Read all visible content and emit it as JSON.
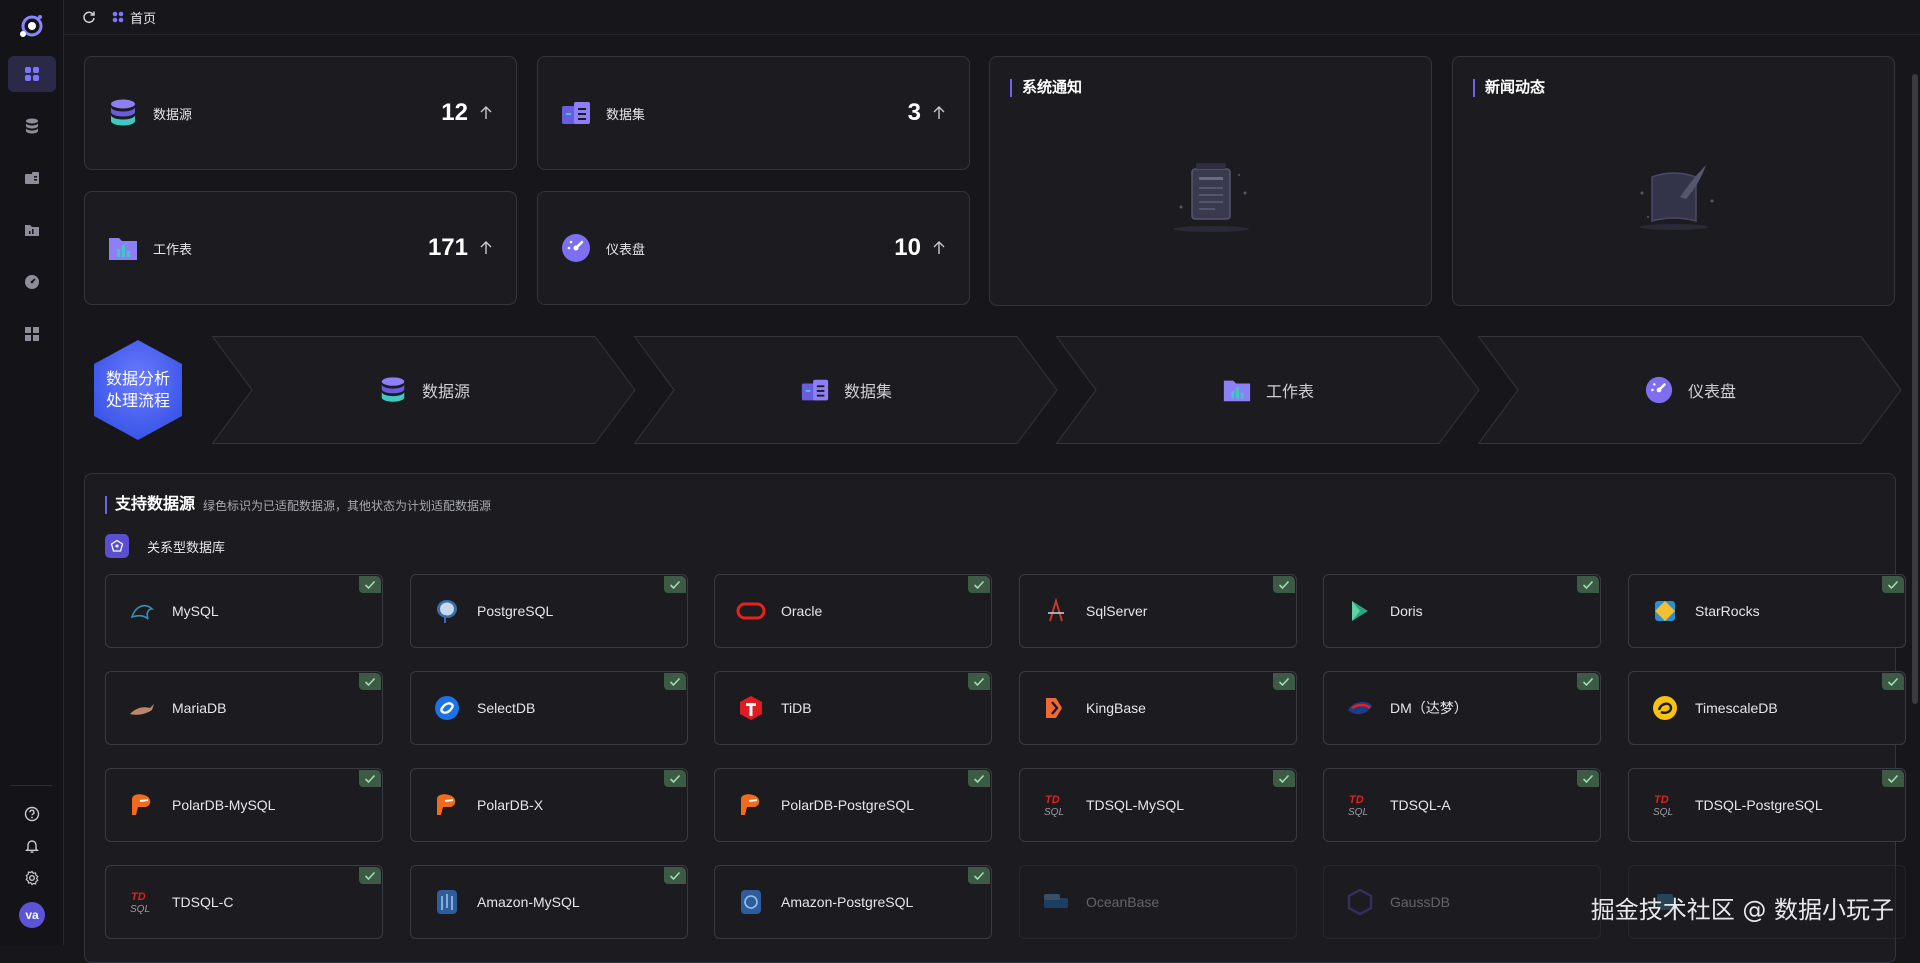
{
  "topbar": {
    "tab_label": "首页"
  },
  "sidebar": {
    "nav": [
      "dashboard-icon",
      "database-icon",
      "dataset-icon",
      "folder-icon",
      "gauge-icon",
      "apps-icon"
    ],
    "bottom": [
      "help-icon",
      "bell-icon",
      "settings-icon"
    ],
    "avatar_text": "va"
  },
  "stats": [
    {
      "label": "数据源",
      "value": "12"
    },
    {
      "label": "数据集",
      "value": "3"
    },
    {
      "label": "工作表",
      "value": "171"
    },
    {
      "label": "仪表盘",
      "value": "10"
    }
  ],
  "notices": [
    {
      "title": "系统通知"
    },
    {
      "title": "新闻动态"
    }
  ],
  "flow": {
    "badge_line1": "数据分析",
    "badge_line2": "处理流程",
    "steps": [
      "数据源",
      "数据集",
      "工作表",
      "仪表盘"
    ]
  },
  "datasources": {
    "title": "支持数据源",
    "subtitle": "绿色标识为已适配数据源，其他状态为计划适配数据源",
    "category": "关系型数据库",
    "items": [
      {
        "name": "MySQL",
        "supported": true
      },
      {
        "name": "PostgreSQL",
        "supported": true
      },
      {
        "name": "Oracle",
        "supported": true
      },
      {
        "name": "SqlServer",
        "supported": true
      },
      {
        "name": "Doris",
        "supported": true
      },
      {
        "name": "StarRocks",
        "supported": true
      },
      {
        "name": "MariaDB",
        "supported": true
      },
      {
        "name": "SelectDB",
        "supported": true
      },
      {
        "name": "TiDB",
        "supported": true
      },
      {
        "name": "KingBase",
        "supported": true
      },
      {
        "name": "DM（达梦）",
        "supported": true
      },
      {
        "name": "TimescaleDB",
        "supported": true
      },
      {
        "name": "PolarDB-MySQL",
        "supported": true
      },
      {
        "name": "PolarDB-X",
        "supported": true
      },
      {
        "name": "PolarDB-PostgreSQL",
        "supported": true
      },
      {
        "name": "TDSQL-MySQL",
        "supported": true
      },
      {
        "name": "TDSQL-A",
        "supported": true
      },
      {
        "name": "TDSQL-PostgreSQL",
        "supported": true
      },
      {
        "name": "TDSQL-C",
        "supported": true
      },
      {
        "name": "Amazon-MySQL",
        "supported": true
      },
      {
        "name": "Amazon-PostgreSQL",
        "supported": true
      },
      {
        "name": "OceanBase",
        "supported": false
      },
      {
        "name": "GaussDB",
        "supported": false
      },
      {
        "name": "",
        "supported": false
      }
    ]
  },
  "watermark": "掘金技术社区 @ 数据小玩子"
}
